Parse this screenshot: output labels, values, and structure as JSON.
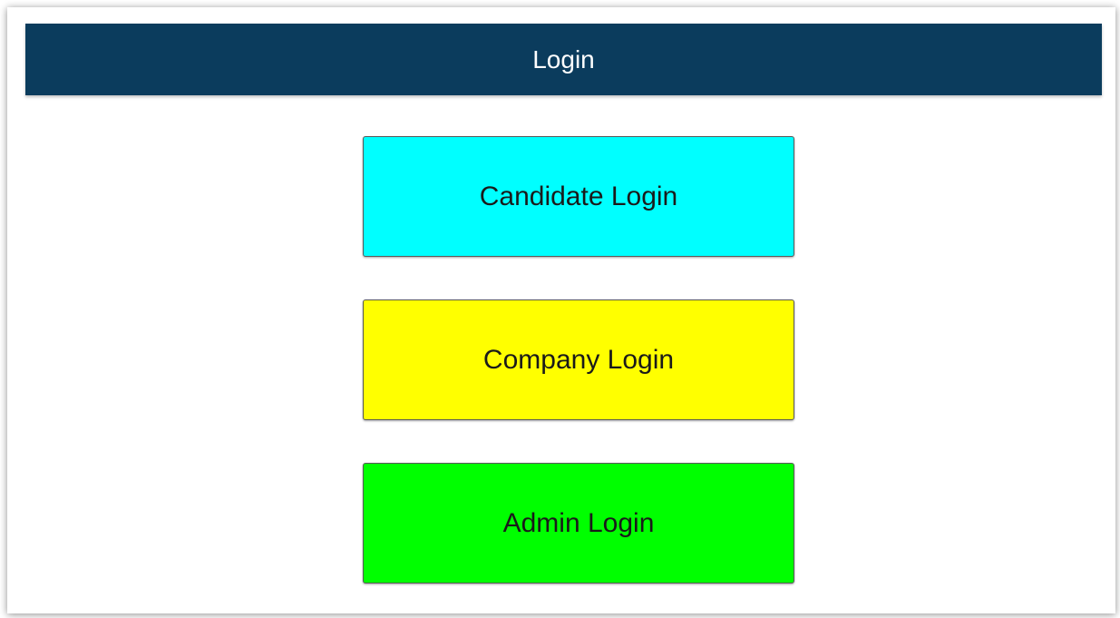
{
  "header": {
    "title": "Login",
    "color": "#0b3c5d"
  },
  "buttons": [
    {
      "label": "Candidate Login",
      "color": "#00ffff"
    },
    {
      "label": "Company Login",
      "color": "#ffff00"
    },
    {
      "label": "Admin Login",
      "color": "#00ff00"
    }
  ]
}
